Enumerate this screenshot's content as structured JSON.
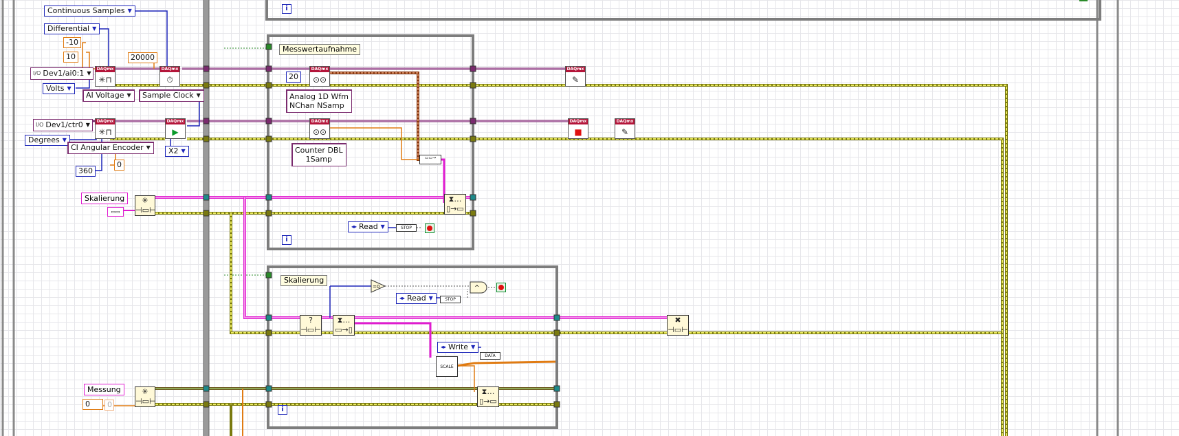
{
  "diagram": {
    "controls": {
      "continuous_samples": "Continuous Samples",
      "differential": "Differential",
      "neg_ten": "-10",
      "ten": "10",
      "dev_ai": "Dev1/ai0:1",
      "volts": "Volts",
      "ai_voltage": "AI Voltage",
      "rate": "20000",
      "sample_clock": "Sample Clock",
      "dev_ctr": "Dev1/ctr0",
      "degrees": "Degrees",
      "ci_angular": "CI Angular Encoder",
      "x2": "X2",
      "zero": "0",
      "three_sixty": "360",
      "skalierung_ctrl": "Skalierung",
      "messung_ctrl": "Messung",
      "messung_zero_a": "0",
      "messung_zero_b": "0"
    },
    "loop1": {
      "label": "Messwertaufnahme",
      "samples": "20",
      "wfm_line1": "Analog 1D Wfm",
      "wfm_line2": "NChan NSamp",
      "counter_line1": "Counter DBL",
      "counter_line2": "1Samp",
      "read_enum": "Read",
      "stop_label": "STOP",
      "iter": "i"
    },
    "loop2": {
      "label": "Skalierung",
      "read_enum": "Read",
      "stop_label": "STOP",
      "write_enum": "Write",
      "data_label": "DATA",
      "scale_label": "SCALE",
      "iter": "i"
    },
    "loop_top": {
      "iter": "i"
    },
    "daq_header": "DAQmx"
  },
  "colors": {
    "task_wire": "#7a2a6e",
    "error_wire": "#c8c82a",
    "cluster_wire": "#e01bd0",
    "number_wire": "#e07b12",
    "frame": "#7d7d7d"
  }
}
